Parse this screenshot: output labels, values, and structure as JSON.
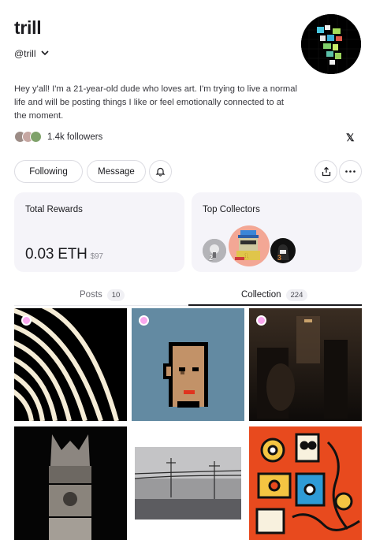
{
  "profile": {
    "name": "trill",
    "handle": "@trill",
    "bio": "Hey y'all! I'm a 21-year-old dude who loves art. I'm trying to live a normal life and will be posting things I like or feel emotionally connected to at the moment.",
    "followers_label": "1.4k followers",
    "social_x": "𝕏"
  },
  "actions": {
    "following_label": "Following",
    "message_label": "Message",
    "bell_icon": "bell-icon",
    "share_icon": "share-icon",
    "more_icon": "more-icon"
  },
  "rewards": {
    "title": "Total Rewards",
    "eth": "0.03 ETH",
    "usd": "$97"
  },
  "collectors": {
    "title": "Top Collectors",
    "ranks": [
      "2",
      "1",
      "3"
    ]
  },
  "tabs": [
    {
      "label": "Posts",
      "count": "10"
    },
    {
      "label": "Collection",
      "count": "224"
    }
  ],
  "active_tab": "Collection",
  "colors": {
    "accent_dot": "#f9a8ee",
    "card_bg": "#f5f4f9"
  }
}
